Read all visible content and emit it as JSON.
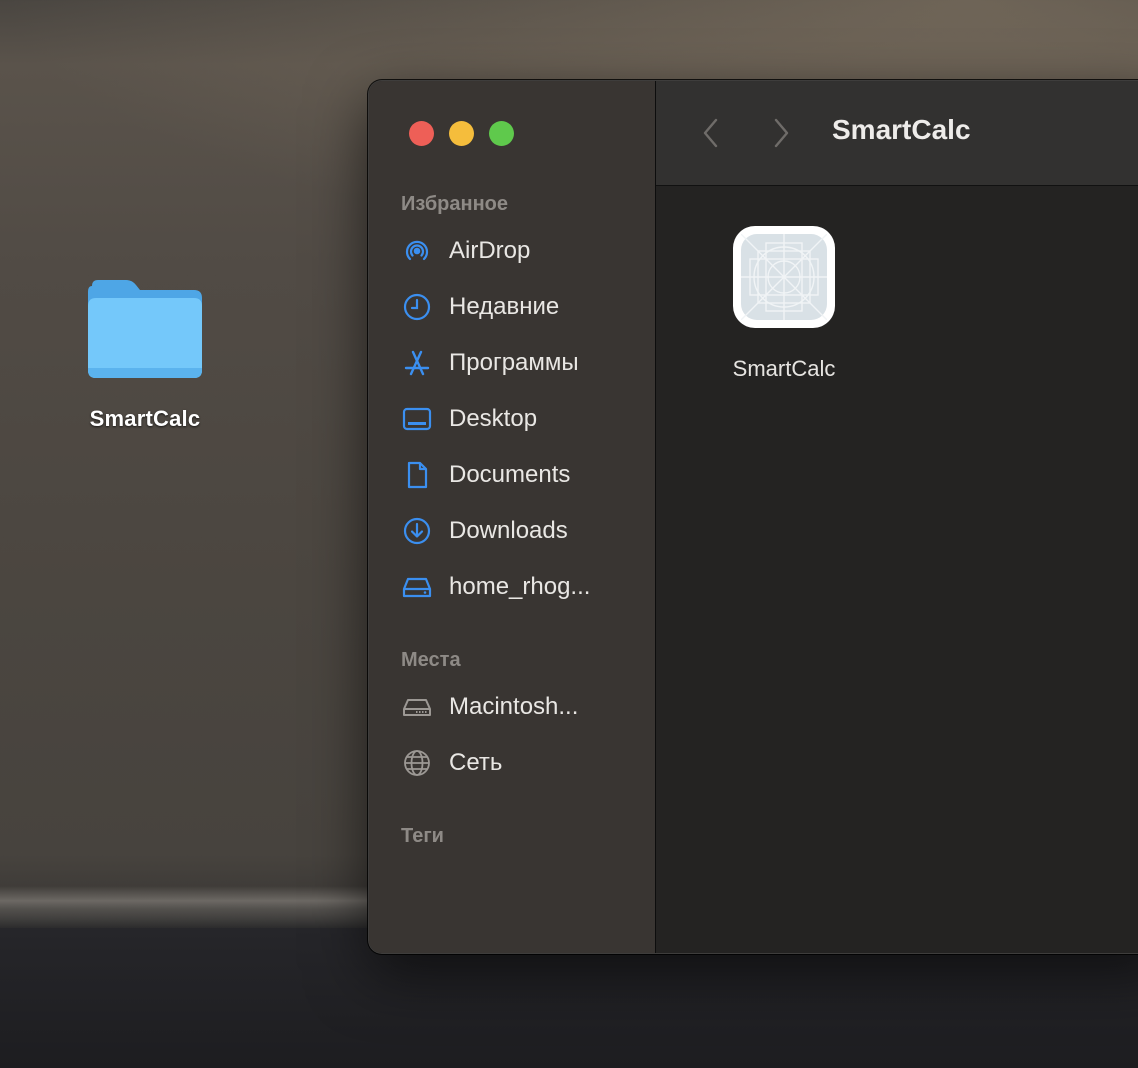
{
  "desktop": {
    "folder_label": "SmartCalc",
    "folder_icon": "folder-icon",
    "folder_color": "#6cc4f6"
  },
  "window": {
    "title": "SmartCalc",
    "traffic_lights": {
      "close": "#ee5f57",
      "minimize": "#f5bd3c",
      "zoom": "#5fc94c"
    },
    "nav": {
      "back_icon": "chevron-left-icon",
      "forward_icon": "chevron-right-icon"
    },
    "sidebar": {
      "favorites_title": "Избранное",
      "favorites": [
        {
          "label": "AirDrop",
          "icon": "airdrop-icon"
        },
        {
          "label": "Недавние",
          "icon": "clock-icon"
        },
        {
          "label": "Программы",
          "icon": "applications-icon"
        },
        {
          "label": "Desktop",
          "icon": "desktop-icon"
        },
        {
          "label": "Documents",
          "icon": "document-icon"
        },
        {
          "label": "Downloads",
          "icon": "download-icon"
        },
        {
          "label": "home_rhog...",
          "icon": "drive-icon"
        }
      ],
      "locations_title": "Места",
      "locations": [
        {
          "label": "Macintosh...",
          "icon": "hard-disk-icon"
        },
        {
          "label": "Сеть",
          "icon": "network-globe-icon"
        }
      ],
      "tags_title": "Теги",
      "accent_color": "#3b8ff0"
    },
    "files": [
      {
        "label": "SmartCalc",
        "icon": "generic-app-icon"
      }
    ]
  }
}
